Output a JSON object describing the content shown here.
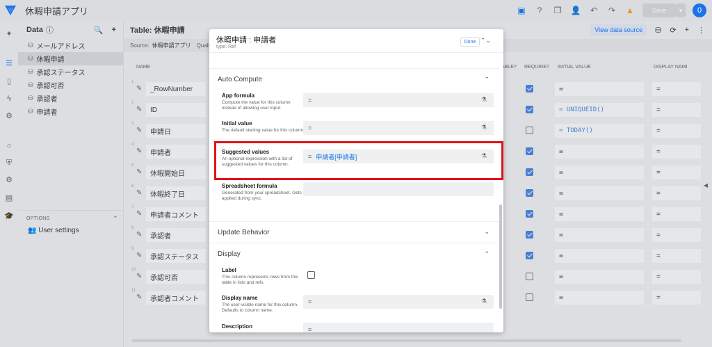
{
  "app": {
    "title": "休暇申請アプリ",
    "save_label": "Save",
    "avatar_initial": "0"
  },
  "data_panel": {
    "title": "Data",
    "items": [
      {
        "label": "メールアドレス",
        "selected": false
      },
      {
        "label": "休暇申請",
        "selected": true
      },
      {
        "label": "承認ステータス",
        "selected": false
      },
      {
        "label": "承認可否",
        "selected": false
      },
      {
        "label": "承認者",
        "selected": false
      },
      {
        "label": "申請者",
        "selected": false
      }
    ],
    "options_title": "OPTIONS",
    "user_settings": "User settings"
  },
  "table": {
    "title": "Table: 休暇申請",
    "view_data_source": "View data source",
    "source_label": "Source:",
    "source_value": "休暇申請アプリ",
    "source_extra": "Quali",
    "columns": {
      "name": "NAME",
      "editable": "ABLE?",
      "require": "REQUIRE?",
      "initial": "INITIAL VALUE",
      "display": "DISPLAY NAMI"
    },
    "rows": [
      {
        "num": "1",
        "name": "_RowNumber",
        "require": true,
        "initial": "=",
        "display": "="
      },
      {
        "num": "2",
        "name": "ID",
        "require": true,
        "initial": "= UNIQUEID()",
        "display": "="
      },
      {
        "num": "3",
        "name": "申請日",
        "require": false,
        "initial": "= TODAY()",
        "display": "="
      },
      {
        "num": "4",
        "name": "申請者",
        "require": true,
        "initial": "=",
        "display": "="
      },
      {
        "num": "5",
        "name": "休暇開始日",
        "require": true,
        "initial": "=",
        "display": "="
      },
      {
        "num": "6",
        "name": "休暇終了日",
        "require": true,
        "initial": "=",
        "display": "="
      },
      {
        "num": "7",
        "name": "申請者コメント",
        "require": true,
        "initial": "=",
        "display": "="
      },
      {
        "num": "8",
        "name": "承認者",
        "require": true,
        "initial": "=",
        "display": "="
      },
      {
        "num": "9",
        "name": "承認ステータス",
        "require": true,
        "initial": "=",
        "display": "="
      },
      {
        "num": "10",
        "name": "承認可否",
        "require": false,
        "initial": "=",
        "display": "="
      },
      {
        "num": "11",
        "name": "承認者コメント",
        "require": false,
        "initial": "=",
        "display": "="
      }
    ]
  },
  "dialog": {
    "title": "休暇申請 : 申請者",
    "type_line": "type: Ref",
    "done_label": "Done",
    "auto_compute": {
      "title": "Auto Compute",
      "app_formula": {
        "label": "App formula",
        "desc": "Compute the value for this column instead of allowing user input.",
        "value": "="
      },
      "initial_value": {
        "label": "Initial value",
        "desc": "The default starting value for this column.",
        "value": "="
      },
      "suggested_values": {
        "label": "Suggested values",
        "desc": "An optional expression with a list of suggested values for this column.",
        "eq": "=",
        "expr": "申請者[申請者]"
      },
      "spreadsheet_formula": {
        "label": "Spreadsheet formula",
        "desc": "Generated from your spreadsheet. Gets applied during sync."
      }
    },
    "update_behavior": {
      "title": "Update Behavior"
    },
    "display": {
      "title": "Display",
      "label": {
        "label": "Label",
        "desc": "This column represents rows from this table in lists and refs."
      },
      "display_name": {
        "label": "Display name",
        "desc": "The user-visible name for this column. Defaults to column name.",
        "value": "="
      },
      "description": {
        "label": "Description",
        "value": "="
      }
    }
  }
}
